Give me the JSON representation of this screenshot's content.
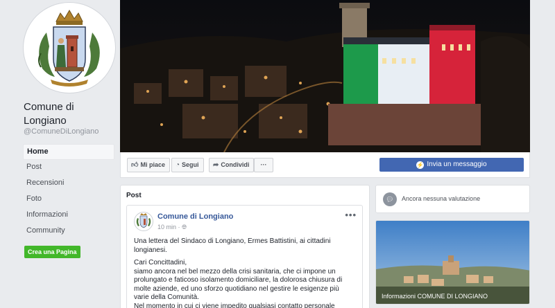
{
  "page": {
    "name": "Comune di Longiano",
    "handle": "@ComuneDiLongiano"
  },
  "nav": {
    "items": [
      {
        "label": "Home",
        "active": true
      },
      {
        "label": "Post"
      },
      {
        "label": "Recensioni"
      },
      {
        "label": "Foto"
      },
      {
        "label": "Informazioni"
      },
      {
        "label": "Community"
      }
    ],
    "create_page": "Crea una Pagina"
  },
  "actions": {
    "like": "Mi piace",
    "follow": "Segui",
    "share": "Condividi",
    "more": "···",
    "message": "Invia un messaggio"
  },
  "posts": {
    "section_title": "Post",
    "author": "Comune di Longiano",
    "time": "10 min",
    "menu": "•••",
    "lead": "Una lettera del Sindaco di Longiano, Ermes Battistini, ai cittadini longianesi.",
    "body_1": "Cari Concittadini,",
    "body_2": "siamo ancora nel bel mezzo della crisi sanitaria, che ci impone un prolungato e faticoso isolamento domiciliare, la dolorosa chiusura di molte aziende, ed uno sforzo quotidiano nel gestire le esigenze più varie della Comunità.",
    "body_3": "Nel momento in cui ci viene impedito qualsiasi contatto personale"
  },
  "sidebar": {
    "rating_text": "Ancora nessuna valutazione",
    "info_label": "Informazioni COMUNE DI LONGIANO"
  },
  "colors": {
    "accent": "#4267b2",
    "link": "#365899",
    "create_page": "#42b72a",
    "flag_green": "#1d9a4b",
    "flag_white": "#e8eef4",
    "flag_red": "#d6233a"
  },
  "icons": {
    "like": "thumbs-up-icon",
    "follow": "rss-icon",
    "share": "share-arrow-icon",
    "message": "messenger-icon",
    "rating": "speech-bubble-icon",
    "post_time": "globe-icon"
  }
}
